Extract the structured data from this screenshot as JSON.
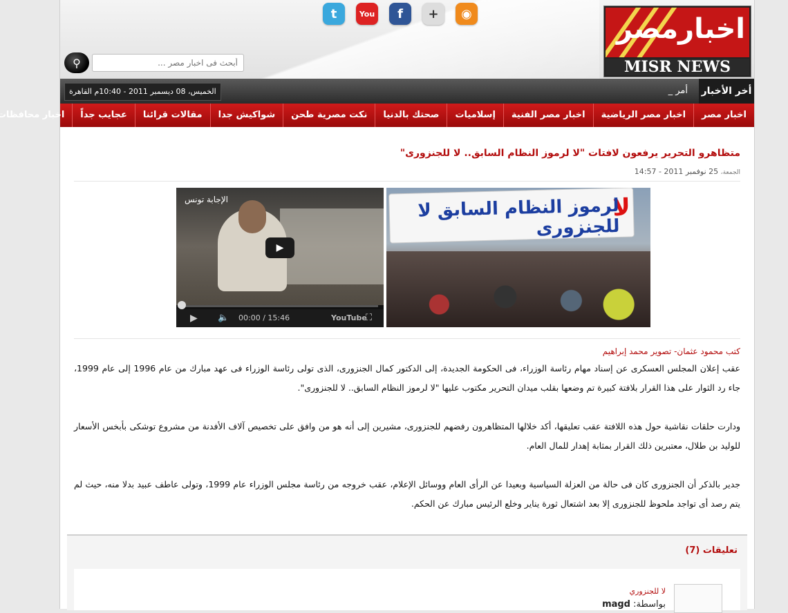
{
  "header": {
    "logo_ar": "اخبارمصر",
    "logo_en": "MISR NEWS",
    "social": [
      {
        "name": "twitter-icon",
        "glyph": "t",
        "color": "#3aa8dd"
      },
      {
        "name": "youtube-icon",
        "glyph": "You",
        "color": "#d22"
      },
      {
        "name": "facebook-icon",
        "glyph": "f",
        "color": "#2f5596"
      },
      {
        "name": "google-plus-icon",
        "glyph": "+",
        "color": "#ddd"
      },
      {
        "name": "rss-icon",
        "glyph": "◉",
        "color": "#f08a1c"
      }
    ],
    "search_placeholder": "أبحث فى اخبار مصر ..."
  },
  "ticker": {
    "label": "أخر الأخبار",
    "item": "أمر _",
    "datetime": "الخميس، 08 ديسمبر 2011 - 10:40م القاهرة"
  },
  "nav": [
    "اخبار مصر",
    "اخبار مصر الرياضية",
    "اخبار مصر الفنية",
    "إسلاميات",
    "صحتك بالدنيا",
    "نكت مصرية طحن",
    "شواكيش جدا",
    "مقالات قرائنا",
    "عجايب جداً",
    "اخبار محافظات"
  ],
  "article": {
    "title": "متظاهرو التحرير يرفعون لافتات \"لا لرموز النظام السابق.. لا للجنزورى\"",
    "date_label": "الجمعة،",
    "date": "25 نوفمبر 2011 - 14:57",
    "video": {
      "title": "الإجابة تونس",
      "time": "00:00 / 15:46",
      "brand": "YouTube"
    },
    "photo_banner": "لرموز النظام السابق لا للجنزورى",
    "photo_banner_la": "لا",
    "author": "كتب محمود عثمان- تصوير محمد إبراهيم",
    "p1": "عقب إعلان المجلس العسكرى عن إسناد مهام رئاسة الوزراء، فى الحكومة الجديدة، إلى الدكتور كمال الجنزورى، الذى تولى رئاسة الوزراء فى عهد مبارك من عام 1996 إلى عام 1999، جاء رد الثوار على هذا القرار بلافتة كبيرة تم وضعها بقلب ميدان التحرير مكتوب عليها \"لا لرموز النظام السابق.. لا للجنزورى\".",
    "p2": "ودارت حلقات نقاشية حول هذه اللافتة عقب تعليقها، أكد خلالها المتظاهرون رفضهم للجنزورى، مشيرين إلى أنه هو من وافق على تخصيص آلاف الأفدنة من مشروع توشكى بأبخس الأسعار للوليد بن طلال، معتبرين ذلك القرار بمثابة إهدار للمال العام.",
    "p3": "جدير بالذكر أن الجنزورى كان فى حالة من العزلة السياسية وبعيدا عن الرأى العام ووسائل الإعلام، عقب خروجه من رئاسة مجلس الوزراء عام 1999، وتولى عاطف عبيد بدلا منه، حيث لم يتم رصد أى تواجد ملحوظ للجنزورى إلا بعد اشتعال ثورة يناير وخلع الرئيس مبارك عن الحكم."
  },
  "comments": {
    "title": "تعليقات (7)",
    "first": {
      "title": "لا للجنزوري",
      "by_label": "بواسطة:",
      "by": "magd"
    }
  }
}
